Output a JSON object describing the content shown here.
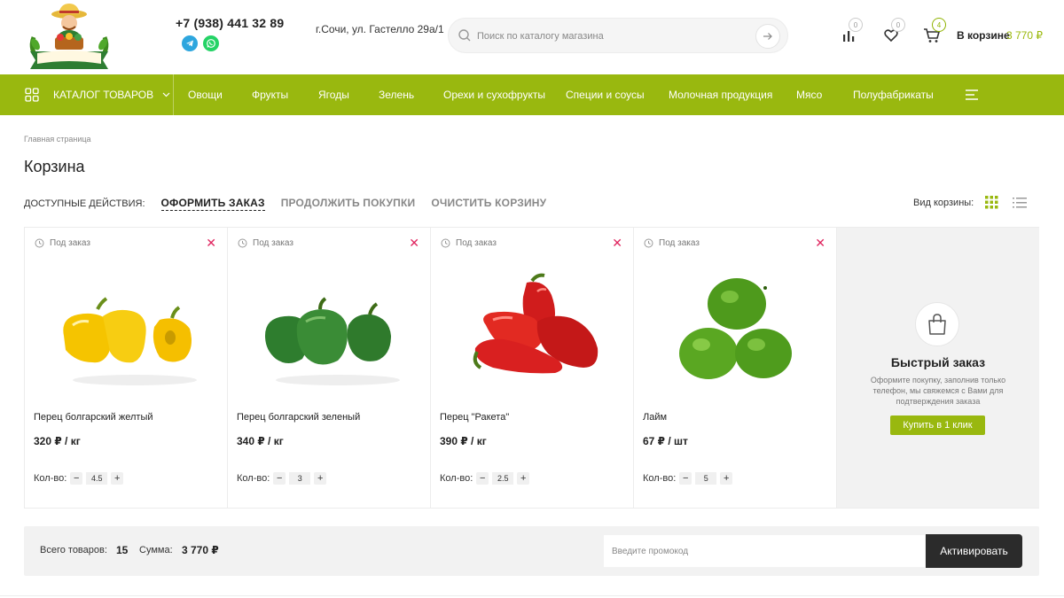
{
  "header": {
    "logo_text": "ФЕРМЕРСКАЯ лавка",
    "phone": "+7 (938) 441 32 89",
    "address": "г.Сочи, ул. Гастелло 29а/1",
    "search_placeholder": "Поиск по каталогу магазина",
    "compare_count": "0",
    "favorites_count": "0",
    "cart_count": "4",
    "cart_label": "В корзине",
    "cart_sum": "3 770 ₽"
  },
  "nav": {
    "catalog_label": "КАТАЛОГ ТОВАРОВ",
    "items": [
      "Овощи",
      "Фрукты",
      "Ягоды",
      "Зелень",
      "Орехи и сухофрукты",
      "Специи и соусы",
      "Молочная продукция",
      "Мясо",
      "Полуфабрикаты"
    ]
  },
  "page": {
    "breadcrumb": "Главная страница",
    "title": "Корзина",
    "actions_label": "ДОСТУПНЫЕ ДЕЙСТВИЯ:",
    "action_order": "ОФОРМИТЬ ЗАКАЗ",
    "action_continue": "ПРОДОЛЖИТЬ ПОКУПКИ",
    "action_clear": "ОЧИСТИТЬ КОРЗИНУ",
    "view_label": "Вид корзины:"
  },
  "products": [
    {
      "status": "Под заказ",
      "name": "Перец болгарский желтый",
      "price": "320 ₽ / кг",
      "qty_label": "Кол-во:",
      "qty": "4.5"
    },
    {
      "status": "Под заказ",
      "name": "Перец болгарский зеленый",
      "price": "340 ₽ / кг",
      "qty_label": "Кол-во:",
      "qty": "3"
    },
    {
      "status": "Под заказ",
      "name": "Перец \"Ракета\"",
      "price": "390 ₽ / кг",
      "qty_label": "Кол-во:",
      "qty": "2.5"
    },
    {
      "status": "Под заказ",
      "name": "Лайм",
      "price": "67 ₽ / шт",
      "qty_label": "Кол-во:",
      "qty": "5"
    }
  ],
  "quick_order": {
    "title": "Быстрый заказ",
    "description": "Оформите покупку, заполнив только телефон, мы свяжемся с Вами для подтверждения заказа",
    "button": "Купить в 1 клик"
  },
  "totals": {
    "items_label": "Всего товаров:",
    "items_value": "15",
    "sum_label": "Сумма:",
    "sum_value": "3 770 ₽",
    "promo_placeholder": "Введите промокод",
    "activate_label": "Активировать"
  },
  "colors": {
    "accent": "#99b80f",
    "remove": "#e0245e",
    "dark_button": "#2b2b2b"
  }
}
